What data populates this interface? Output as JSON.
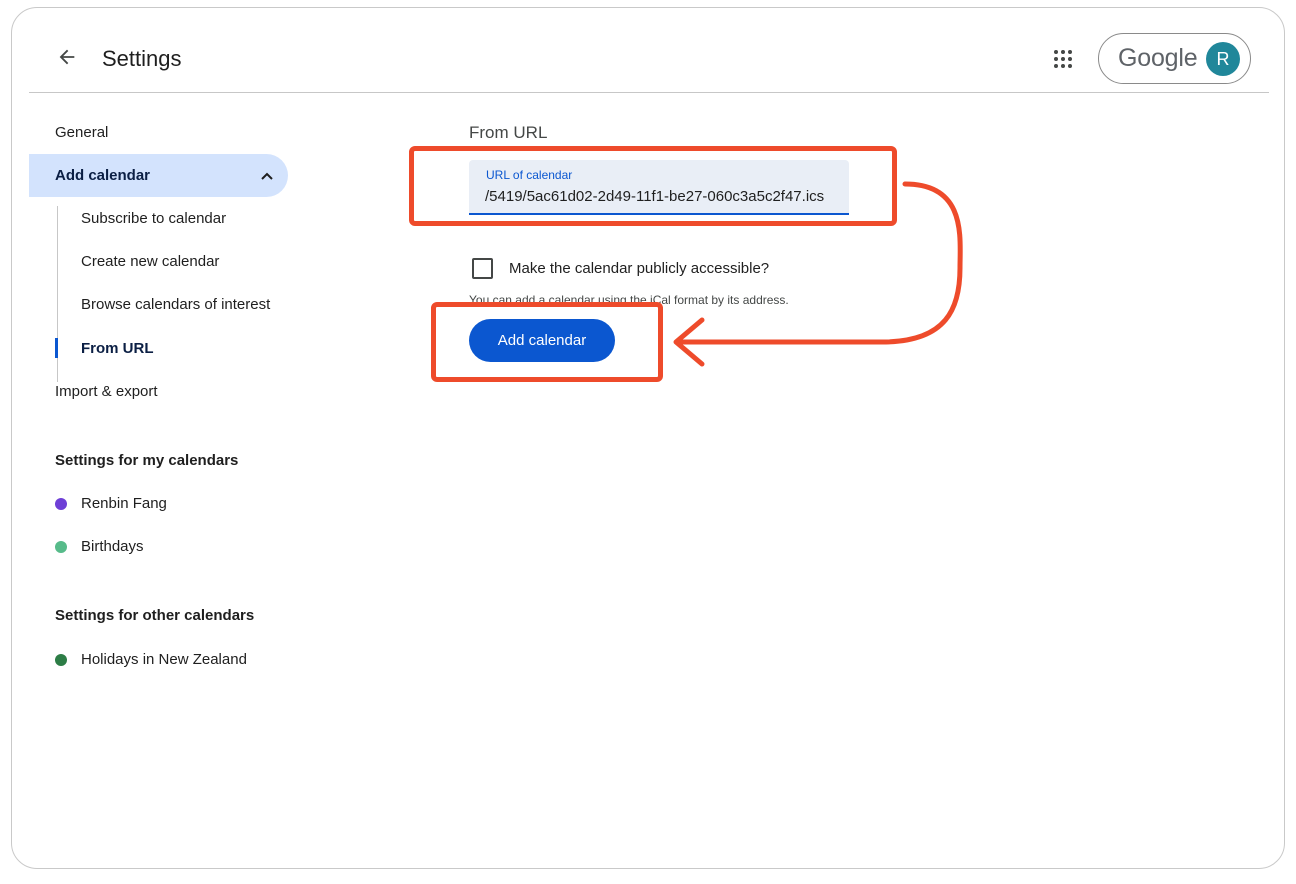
{
  "header": {
    "title": "Settings",
    "brand": "Google",
    "avatar_initial": "R"
  },
  "sidebar": {
    "general": "General",
    "add_calendar": "Add calendar",
    "sub_items": [
      "Subscribe to calendar",
      "Create new calendar",
      "Browse calendars of interest",
      "From URL"
    ],
    "import_export": "Import & export",
    "my_calendars_heading": "Settings for my calendars",
    "my_calendars": [
      {
        "name": "Renbin Fang",
        "color": "#6e3fd6"
      },
      {
        "name": "Birthdays",
        "color": "#57bb8a"
      }
    ],
    "other_calendars_heading": "Settings for other calendars",
    "other_calendars": [
      {
        "name": "Holidays in New Zealand",
        "color": "#2d7d46"
      }
    ]
  },
  "main": {
    "section_title": "From URL",
    "url_field": {
      "label": "URL of calendar",
      "value": "/5419/5ac61d02-2d49-11f1-be27-060c3a5c2f47.ics"
    },
    "public_checkbox": {
      "label": "Make the calendar publicly accessible?",
      "checked": false
    },
    "helper_text": "You can add a calendar using the iCal format by its address.",
    "add_button": "Add calendar"
  },
  "colors": {
    "accent": "#0b57d0",
    "active_nav": "#d3e3fd",
    "annotation": "#ee4b2b"
  }
}
